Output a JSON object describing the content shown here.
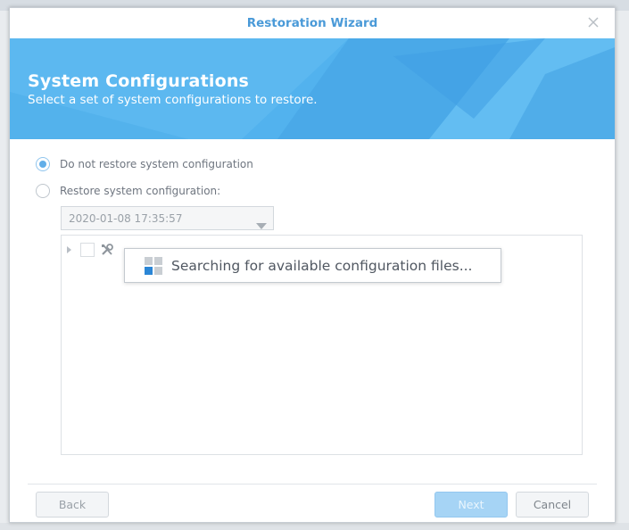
{
  "window": {
    "title": "Restoration Wizard",
    "close_icon": "close-icon"
  },
  "banner": {
    "title": "System Configurations",
    "subtitle": "Select a set of system configurations to restore.",
    "color": "#52b2ee"
  },
  "options": {
    "no_restore_label": "Do not restore system configuration",
    "restore_label": "Restore system configuration:",
    "selected": "no_restore"
  },
  "backup_select": {
    "value": "2020-01-08 17:35:57"
  },
  "tree": {
    "icon": "tools-icon"
  },
  "status": {
    "message": "Searching for available configuration files...",
    "icon": "loading-grid-icon"
  },
  "footer": {
    "back_label": "Back",
    "next_label": "Next",
    "cancel_label": "Cancel"
  },
  "colors": {
    "accent": "#4a9ad8",
    "radio_checked": "#62aee8",
    "next_button": "#a6d4f5"
  }
}
